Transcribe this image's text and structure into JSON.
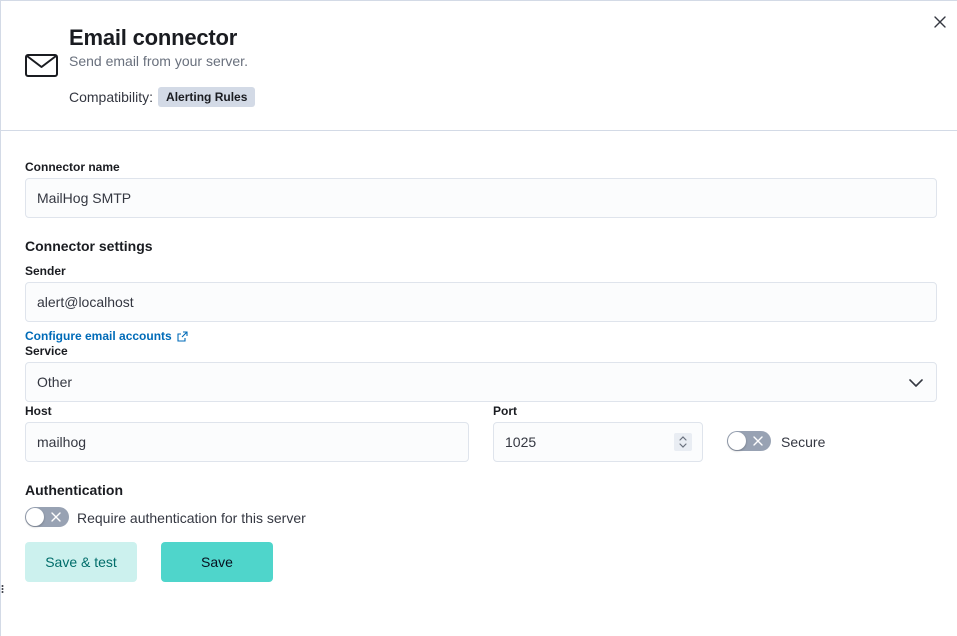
{
  "header": {
    "title": "Email connector",
    "subtitle": "Send email from your server.",
    "compatibility_label": "Compatibility:",
    "compatibility_badge": "Alerting Rules"
  },
  "form": {
    "connector_name": {
      "label": "Connector name",
      "value": "MailHog SMTP"
    },
    "connector_settings_title": "Connector settings",
    "sender": {
      "label": "Sender",
      "value": "alert@localhost"
    },
    "configure_link": "Configure email accounts",
    "service": {
      "label": "Service",
      "value": "Other"
    },
    "host": {
      "label": "Host",
      "value": "mailhog"
    },
    "port": {
      "label": "Port",
      "value": "1025"
    },
    "secure": {
      "label": "Secure",
      "enabled": false
    },
    "authentication_title": "Authentication",
    "require_auth": {
      "label": "Require authentication for this server",
      "enabled": false
    }
  },
  "buttons": {
    "save_test": "Save & test",
    "save": "Save"
  },
  "icons": {
    "close": "close-icon",
    "header": "envelope-icon",
    "external": "external-link-icon",
    "chevron": "chevron-down-icon",
    "stepper": "stepper-icon",
    "toggle_off": "cross-icon"
  },
  "colors": {
    "primary": "#4fd5cb",
    "secondary": "#ccf1ee",
    "link": "#006bb8",
    "badge": "#d3dae6"
  }
}
